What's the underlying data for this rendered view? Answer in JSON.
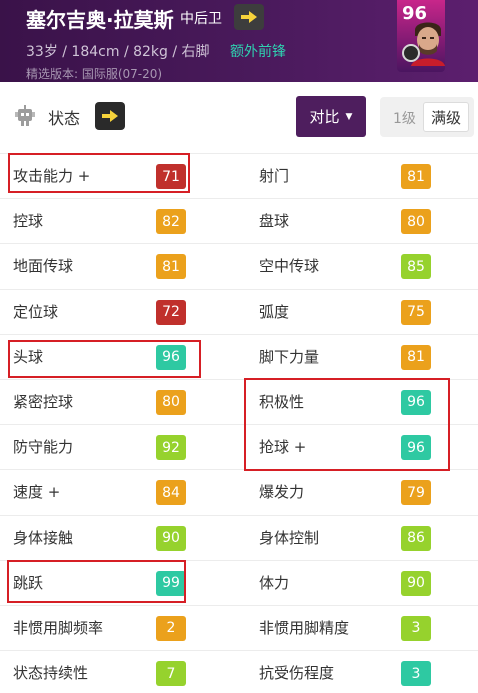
{
  "header": {
    "player_name": "塞尔吉奥·拉莫斯",
    "position": "中后卫",
    "bio": "33岁 / 184cm / 82kg / 右脚",
    "extra_position": "额外前锋",
    "version": "精选版本: 国际服(07-20)",
    "card_rating": "96",
    "colors": {
      "bg": "#4a1a5c",
      "extra_position": "#2fd0b0"
    }
  },
  "toolbar": {
    "status_label": "状态",
    "compare_label": "对比",
    "level_1_label": "1级",
    "level_max_label": "满级"
  },
  "stat_colors": {
    "red": "#c0302c",
    "orange": "#eba11c",
    "lightgreen": "#96d22d",
    "teal": "#2ec9a2"
  },
  "stats": [
    {
      "left": {
        "name": "攻击能力 +",
        "value": "71",
        "color": "#c0302c"
      },
      "right": {
        "name": "射门",
        "value": "81",
        "color": "#eba11c"
      }
    },
    {
      "left": {
        "name": "控球",
        "value": "82",
        "color": "#eba11c"
      },
      "right": {
        "name": "盘球",
        "value": "80",
        "color": "#eba11c"
      }
    },
    {
      "left": {
        "name": "地面传球",
        "value": "81",
        "color": "#eba11c"
      },
      "right": {
        "name": "空中传球",
        "value": "85",
        "color": "#96d22d"
      }
    },
    {
      "left": {
        "name": "定位球",
        "value": "72",
        "color": "#c0302c"
      },
      "right": {
        "name": "弧度",
        "value": "75",
        "color": "#eba11c"
      }
    },
    {
      "left": {
        "name": "头球",
        "value": "96",
        "color": "#2ec9a2"
      },
      "right": {
        "name": "脚下力量",
        "value": "81",
        "color": "#eba11c"
      }
    },
    {
      "left": {
        "name": "紧密控球",
        "value": "80",
        "color": "#eba11c"
      },
      "right": {
        "name": "积极性",
        "value": "96",
        "color": "#2ec9a2"
      }
    },
    {
      "left": {
        "name": "防守能力",
        "value": "92",
        "color": "#96d22d"
      },
      "right": {
        "name": "抢球 +",
        "value": "96",
        "color": "#2ec9a2"
      }
    },
    {
      "left": {
        "name": "速度 +",
        "value": "84",
        "color": "#eba11c"
      },
      "right": {
        "name": "爆发力",
        "value": "79",
        "color": "#eba11c"
      }
    },
    {
      "left": {
        "name": "身体接触",
        "value": "90",
        "color": "#96d22d"
      },
      "right": {
        "name": "身体控制",
        "value": "86",
        "color": "#96d22d"
      }
    },
    {
      "left": {
        "name": "跳跃",
        "value": "99",
        "color": "#2ec9a2"
      },
      "right": {
        "name": "体力",
        "value": "90",
        "color": "#96d22d"
      }
    },
    {
      "left": {
        "name": "非惯用脚频率",
        "value": "2",
        "color": "#eba11c"
      },
      "right": {
        "name": "非惯用脚精度",
        "value": "3",
        "color": "#96d22d"
      }
    },
    {
      "left": {
        "name": "状态持续性",
        "value": "7",
        "color": "#96d22d"
      },
      "right": {
        "name": "抗受伤程度",
        "value": "3",
        "color": "#2ec9a2"
      }
    }
  ],
  "highlight_color": "#d61f25"
}
